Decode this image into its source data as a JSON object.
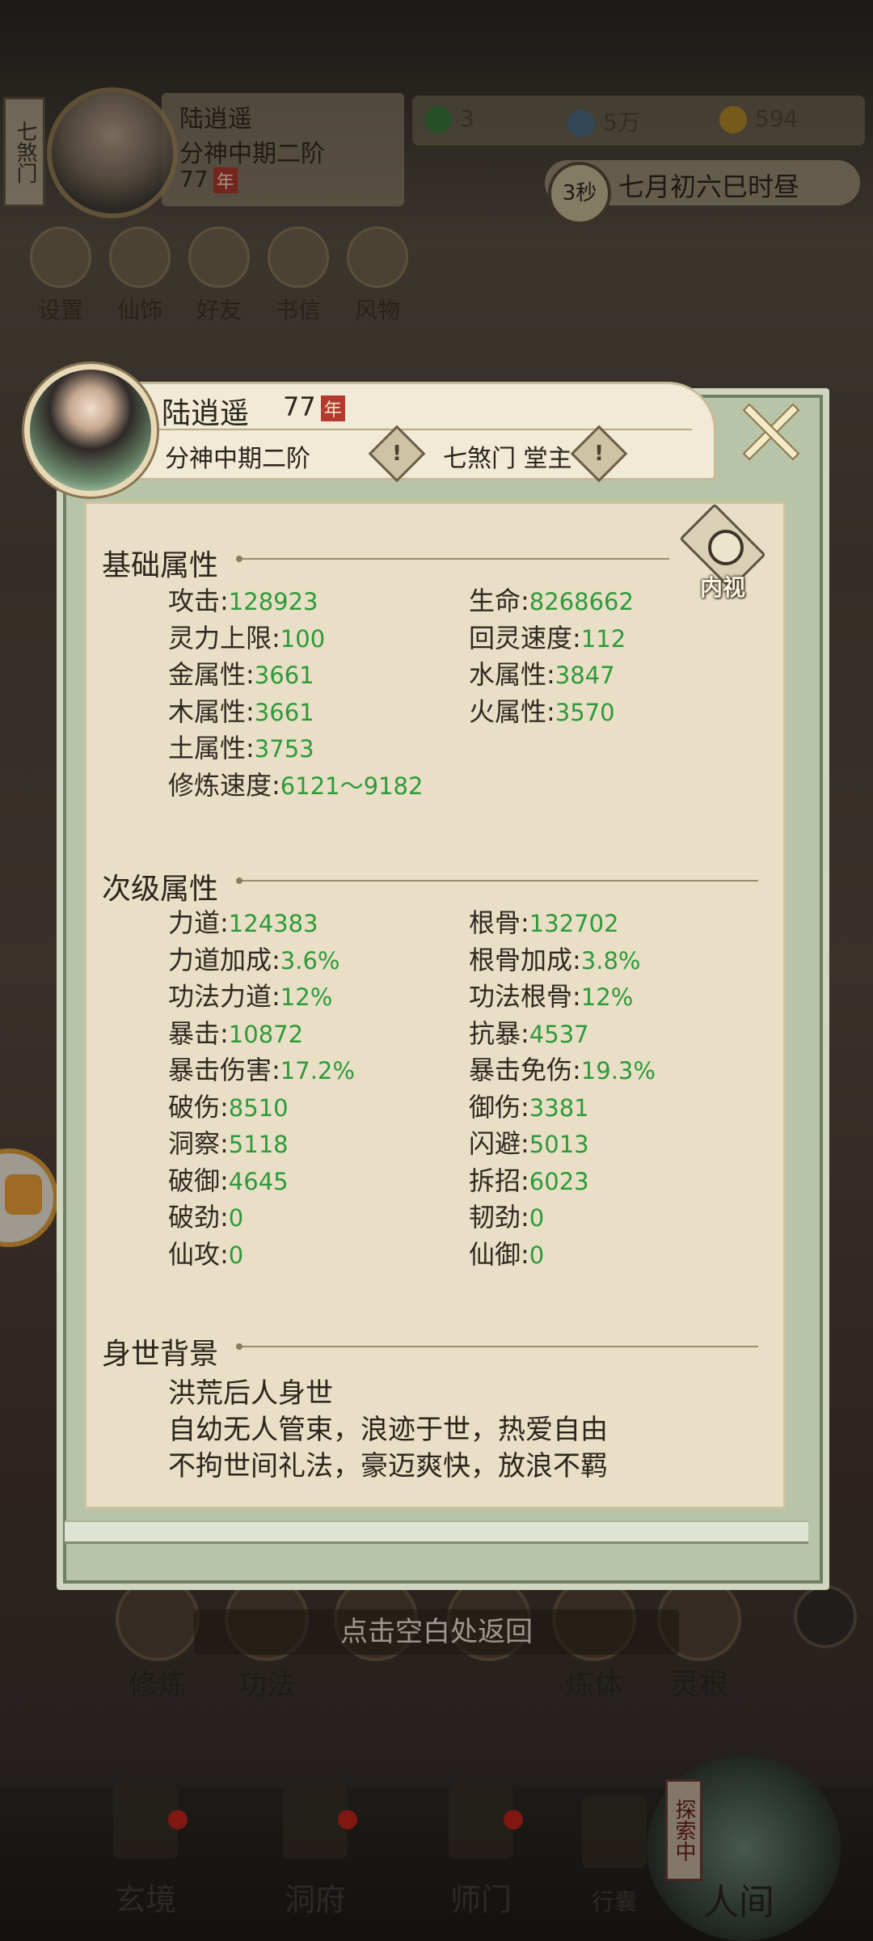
{
  "topbar": {
    "sect_tag": "七煞门",
    "name": "陆逍遥",
    "realm": "分神中期二阶",
    "age": "77",
    "age_unit": "年",
    "resources": [
      {
        "icon": "leaf-icon",
        "value": "3"
      },
      {
        "icon": "coin-icon",
        "value": "5万"
      },
      {
        "icon": "ingot-icon",
        "value": "594"
      }
    ],
    "timer": "3秒",
    "game_time": "七月初六巳时昼",
    "quick": [
      "设置",
      "仙饰",
      "好友",
      "书信",
      "风物"
    ]
  },
  "panel": {
    "name": "陆逍遥",
    "age": "77",
    "age_unit": "年",
    "realm": "分神中期二阶",
    "sect": "七煞门 堂主",
    "neishi": "内视",
    "basic_title": "基础属性",
    "basic": [
      {
        "label": "攻击",
        "value": "128923"
      },
      {
        "label": "生命",
        "value": "8268662"
      },
      {
        "label": "灵力上限",
        "value": "100"
      },
      {
        "label": "回灵速度",
        "value": "112"
      },
      {
        "label": "金属性",
        "value": "3661"
      },
      {
        "label": "水属性",
        "value": "3847"
      },
      {
        "label": "木属性",
        "value": "3661"
      },
      {
        "label": "火属性",
        "value": "3570"
      },
      {
        "label": "土属性",
        "value": "3753"
      },
      {
        "label": "修炼速度",
        "value": "6121～9182"
      }
    ],
    "secondary_title": "次级属性",
    "secondary": [
      {
        "label": "力道",
        "value": "124383"
      },
      {
        "label": "根骨",
        "value": "132702"
      },
      {
        "label": "力道加成",
        "value": "3.6%"
      },
      {
        "label": "根骨加成",
        "value": "3.8%"
      },
      {
        "label": "功法力道",
        "value": "12%"
      },
      {
        "label": "功法根骨",
        "value": "12%"
      },
      {
        "label": "暴击",
        "value": "10872"
      },
      {
        "label": "抗暴",
        "value": "4537"
      },
      {
        "label": "暴击伤害",
        "value": "17.2%"
      },
      {
        "label": "暴击免伤",
        "value": "19.3%"
      },
      {
        "label": "破伤",
        "value": "8510"
      },
      {
        "label": "御伤",
        "value": "3381"
      },
      {
        "label": "洞察",
        "value": "5118"
      },
      {
        "label": "闪避",
        "value": "5013"
      },
      {
        "label": "破御",
        "value": "4645"
      },
      {
        "label": "拆招",
        "value": "6023"
      },
      {
        "label": "破劲",
        "value": "0"
      },
      {
        "label": "韧劲",
        "value": "0"
      },
      {
        "label": "仙攻",
        "value": "0"
      },
      {
        "label": "仙御",
        "value": "0"
      }
    ],
    "background_title": "身世背景",
    "background": [
      "洪荒后人身世",
      "自幼无人管束，浪迹于世，热爱自由",
      "不拘世间礼法，豪迈爽快，放浪不羁"
    ]
  },
  "hint": "点击空白处返回",
  "action_row": [
    "修炼",
    "功法",
    "",
    "",
    "炼体",
    "灵根"
  ],
  "nav": [
    "玄境",
    "洞府",
    "师门",
    "行囊",
    "人间"
  ],
  "explore_tag": "探索中"
}
